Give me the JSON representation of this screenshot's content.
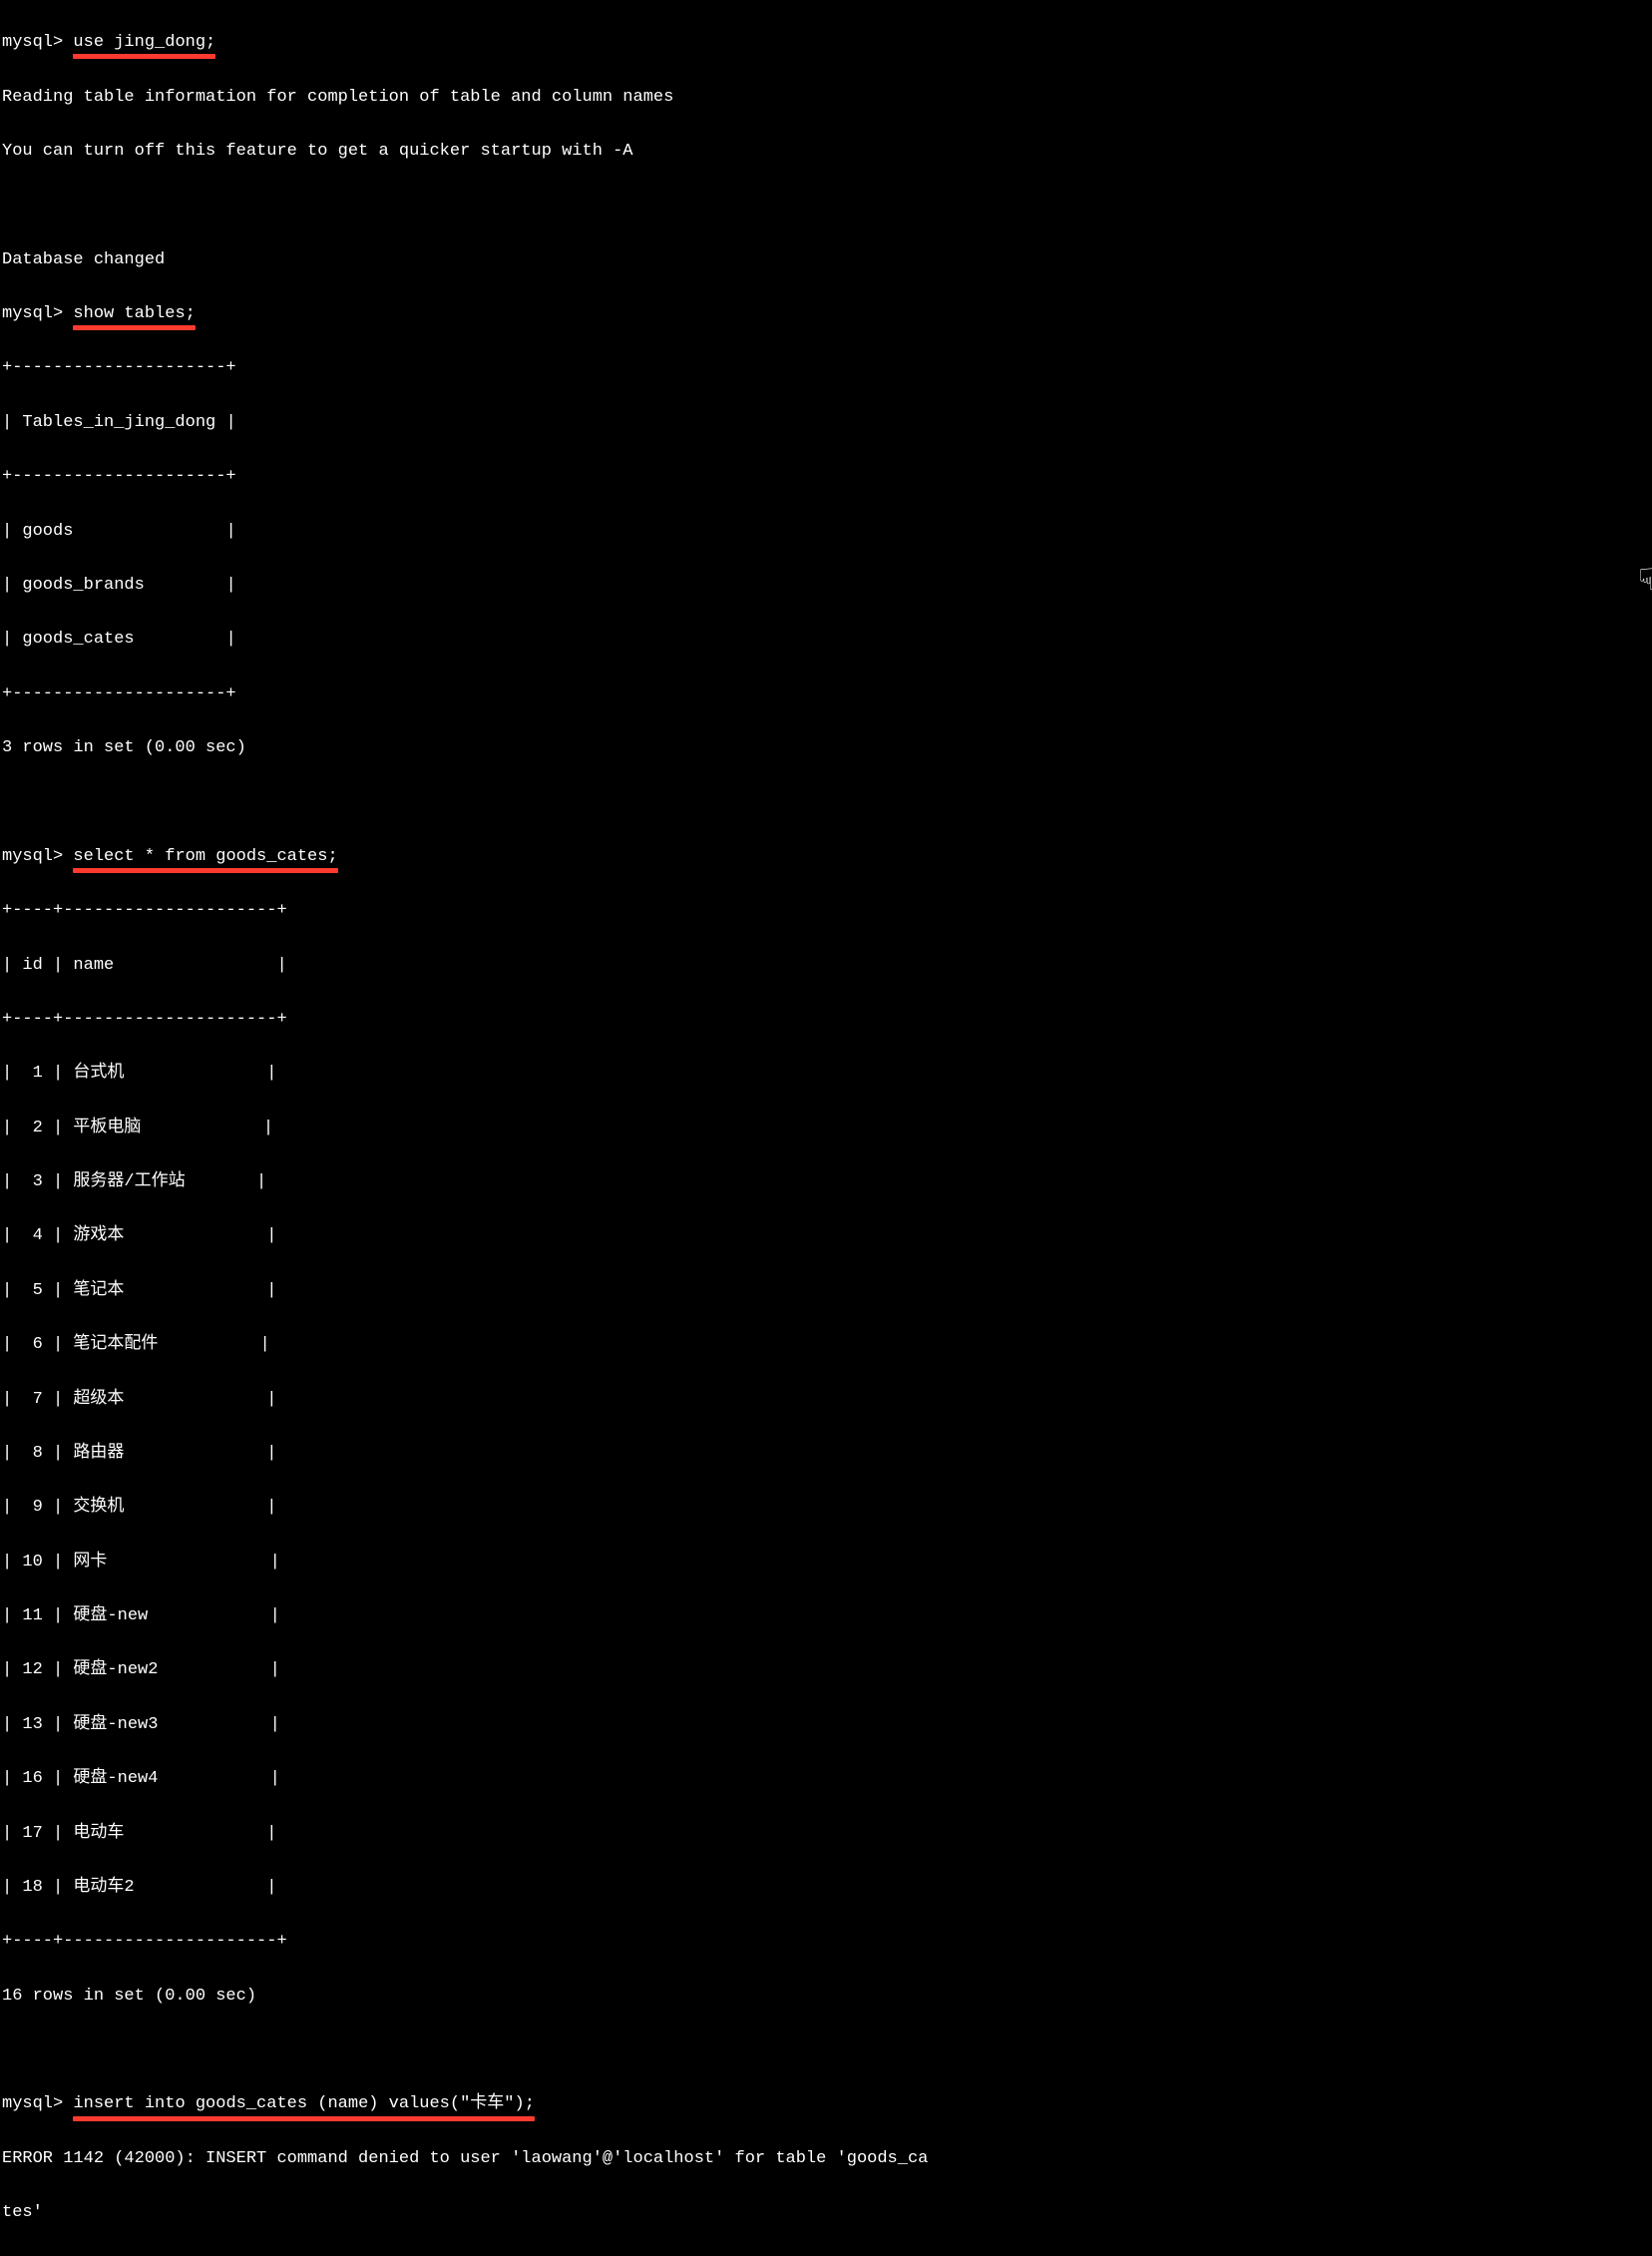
{
  "prompt": "mysql>",
  "cmd1": "use jing_dong;",
  "msg_reading": "Reading table information for completion of table and column names",
  "msg_turnoff": "You can turn off this feature to get a quicker startup with -A",
  "msg_dbchanged": "Database changed",
  "cmd2": "show tables;",
  "tables_header": "Tables_in_jing_dong",
  "tables_border_top": "+---------------------+",
  "tables": {
    "r0": "goods",
    "r1": "goods_brands",
    "r2": "goods_cates"
  },
  "tables_footer": "3 rows in set (0.00 sec)",
  "cmd3": "select * from goods_cates;",
  "cates_border": "+----+---------------------+",
  "cates_header": {
    "c0": "id",
    "c1": "name"
  },
  "cates": {
    "r0": {
      "id": " 1",
      "name": "台式机"
    },
    "r1": {
      "id": " 2",
      "name": "平板电脑"
    },
    "r2": {
      "id": " 3",
      "name": "服务器/工作站"
    },
    "r3": {
      "id": " 4",
      "name": "游戏本"
    },
    "r4": {
      "id": " 5",
      "name": "笔记本"
    },
    "r5": {
      "id": " 6",
      "name": "笔记本配件"
    },
    "r6": {
      "id": " 7",
      "name": "超级本"
    },
    "r7": {
      "id": " 8",
      "name": "路由器"
    },
    "r8": {
      "id": " 9",
      "name": "交换机"
    },
    "r9": {
      "id": "10",
      "name": "网卡"
    },
    "r10": {
      "id": "11",
      "name": "硬盘-new"
    },
    "r11": {
      "id": "12",
      "name": "硬盘-new2"
    },
    "r12": {
      "id": "13",
      "name": "硬盘-new3"
    },
    "r13": {
      "id": "16",
      "name": "硬盘-new4"
    },
    "r14": {
      "id": "17",
      "name": "电动车"
    },
    "r15": {
      "id": "18",
      "name": "电动车2"
    }
  },
  "cates_footer": "16 rows in set (0.00 sec)",
  "cmd4": "insert into goods_cates (name) values(\"卡车\");",
  "error": "ERROR 1142 (42000): INSERT command denied to user 'laowang'@'localhost' for table 'goods_ca",
  "error2": "tes'"
}
